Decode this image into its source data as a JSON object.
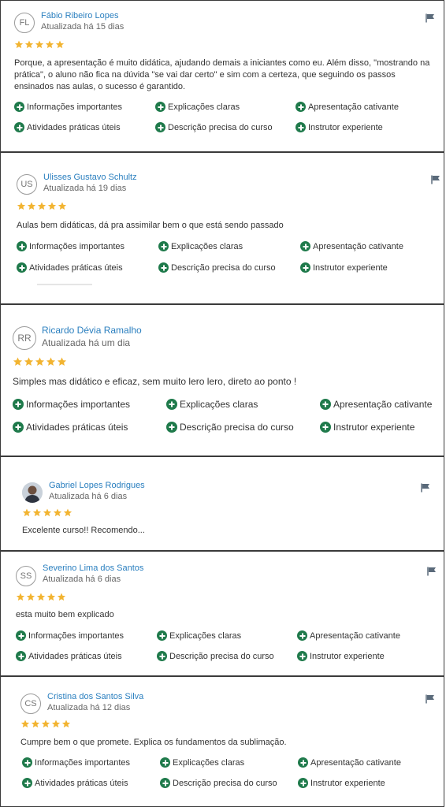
{
  "colors": {
    "link": "#2a7fbf",
    "star": "#f2b431",
    "tag_icon": "#1f7a4b",
    "flag": "#5a6a7a"
  },
  "reviews": [
    {
      "initials": "FL",
      "name": "Fábio Ribeiro Lopes",
      "updated": "Atualizada há 15 dias",
      "rating": 5,
      "text": "Porque, a apresentação é muito didática, ajudando demais a iniciantes como eu. Além disso, \"mostrando na prática\", o aluno não fica na dúvida \"se vai dar certo\" e sim com a certeza, que seguindo os passos ensinados nas aulas, o sucesso é garantido.",
      "tags": [
        "Informações importantes",
        "Explicações claras",
        "Apresentação cativante",
        "Atividades práticas úteis",
        "Descrição precisa do curso",
        "Instrutor experiente"
      ]
    },
    {
      "initials": "US",
      "name": "Ulisses Gustavo Schultz",
      "updated": "Atualizada há 19 dias",
      "rating": 5,
      "text": "Aulas bem didáticas, dá pra assimilar bem o que está sendo passado",
      "tags": [
        "Informações importantes",
        "Explicações claras",
        "Apresentação cativante",
        "Atividades práticas úteis",
        "Descrição precisa do curso",
        "Instrutor experiente"
      ]
    },
    {
      "initials": "RR",
      "name": "Ricardo Dévia Ramalho",
      "updated": "Atualizada há um dia",
      "rating": 5,
      "text": "Simples mas didático e eficaz, sem muito lero lero, direto ao ponto !",
      "tags": [
        "Informações importantes",
        "Explicações claras",
        "Apresentação cativante",
        "Atividades práticas úteis",
        "Descrição precisa do curso",
        "Instrutor experiente"
      ]
    },
    {
      "initials": "",
      "name": "Gabriel Lopes Rodrigues",
      "updated": "Atualizada há 6 dias",
      "rating": 5,
      "text": "Excelente curso!! Recomendo...",
      "tags": []
    },
    {
      "initials": "SS",
      "name": "Severino Lima dos Santos",
      "updated": "Atualizada há 6 dias",
      "rating": 5,
      "text": "esta muito bem explicado",
      "tags": [
        "Informações importantes",
        "Explicações claras",
        "Apresentação cativante",
        "Atividades práticas úteis",
        "Descrição precisa do curso",
        "Instrutor experiente"
      ]
    },
    {
      "initials": "CS",
      "name": "Cristina dos Santos Silva",
      "updated": "Atualizada há 12 dias",
      "rating": 5,
      "text": "Cumpre bem o que promete. Explica os fundamentos da sublimação.",
      "tags": [
        "Informações importantes",
        "Explicações claras",
        "Apresentação cativante",
        "Atividades práticas úteis",
        "Descrição precisa do curso",
        "Instrutor experiente"
      ]
    }
  ]
}
